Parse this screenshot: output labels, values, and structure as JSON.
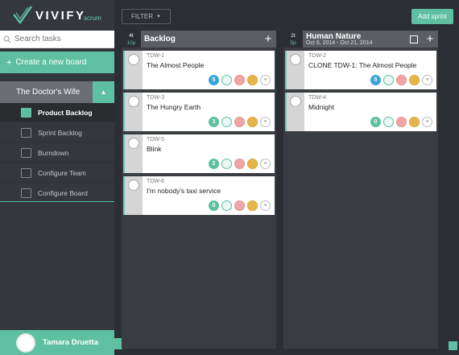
{
  "app": {
    "brand": "VIVIFY",
    "brand_sub": "scrum"
  },
  "toolbar": {
    "filter_label": "FILTER",
    "add_sprint_label": "Add sprint"
  },
  "sidebar": {
    "search_placeholder": "Search tasks",
    "create_board_label": "Create a new board",
    "board_name": "The Doctor's Wife",
    "items": [
      {
        "label": "Product Backlog",
        "icon": "backlog-icon",
        "active": true
      },
      {
        "label": "Sprint Backlog",
        "icon": "sprint-icon",
        "active": false
      },
      {
        "label": "Burndown",
        "icon": "chart-icon",
        "active": false
      },
      {
        "label": "Configure Team",
        "icon": "team-icon",
        "active": false
      },
      {
        "label": "Configure Board",
        "icon": "board-icon",
        "active": false
      }
    ],
    "user_name": "Tamara Druetta"
  },
  "columns": [
    {
      "tasks_count": "4t",
      "points": "10p",
      "title": "Backlog",
      "dates": "",
      "cards": [
        {
          "id": "TDW-1",
          "title": "The Almost People",
          "points": "5",
          "color": "blue"
        },
        {
          "id": "TDW-3",
          "title": "The Hungry Earth",
          "points": "3",
          "color": "green"
        },
        {
          "id": "TDW-5",
          "title": "Blink",
          "points": "2",
          "color": "green"
        },
        {
          "id": "TDW-6",
          "title": "I'm nobody's taxi service",
          "points": "0",
          "color": "green"
        }
      ]
    },
    {
      "tasks_count": "2t",
      "points": "5p",
      "title": "Human Nature",
      "dates": "Oct 6, 2014 - Oct 21, 2014",
      "cards": [
        {
          "id": "TDW-2",
          "title": "CLONE TDW-1: The Almost People",
          "points": "5",
          "color": "blue"
        },
        {
          "id": "TDW-4",
          "title": "Midnight",
          "points": "0",
          "color": "green"
        }
      ]
    }
  ],
  "colors": {
    "accent": "#5ec0a0",
    "points_blue": "#3ba4d8",
    "dark": "#2b2e33"
  }
}
